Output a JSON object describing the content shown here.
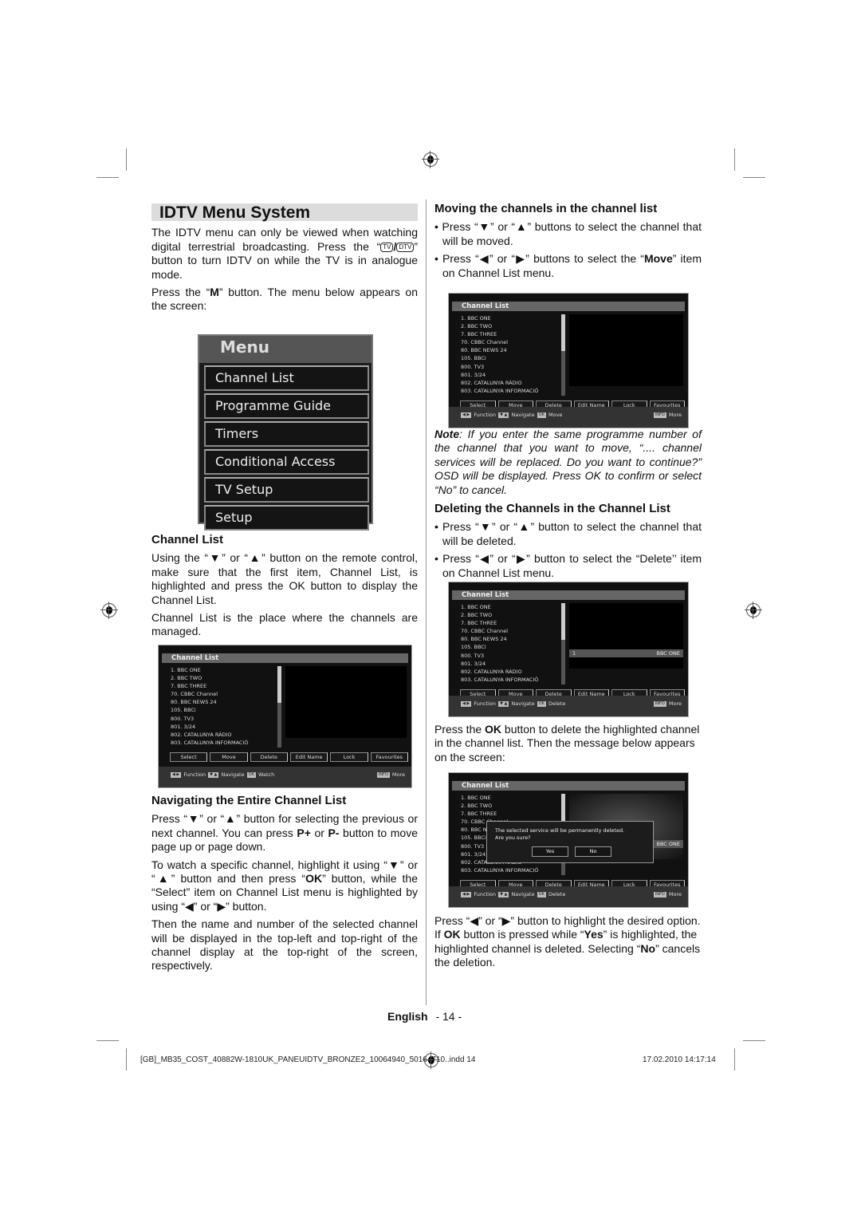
{
  "page": {
    "language_label": "English",
    "page_number": "- 14 -",
    "footer_file": "[GB]_MB35_COST_40882W-1810UK_PANEUIDTV_BRONZE2_10064940_50164710..indd  14",
    "footer_datetime": "17.02.2010  14:17:14"
  },
  "left": {
    "title": "IDTV Menu System",
    "intro_1a": "The IDTV menu can only be viewed when watching digital terrestrial broadcasting. Press the “",
    "tv_key": "TV",
    "slash": "/",
    "dtv_key": "DTV",
    "intro_1b": "” button to turn IDTV on while the TV is in analogue mode.",
    "intro_2a": "Press the “",
    "intro_2_key": "M",
    "intro_2b": "” button. The menu below appears on the screen:",
    "menu": {
      "title": "Menu",
      "items": [
        "Channel List",
        "Programme Guide",
        "Timers",
        "Conditional Access",
        "TV Setup",
        "Setup"
      ]
    },
    "channel_list_heading": "Channel List",
    "channel_list_p1": "Using the “▼” or “▲” button on the remote control, make sure that the first item, Channel List, is highlighted and press the OK button to display the Channel List.",
    "channel_list_p2": "Channel List is the place where the channels are managed.",
    "nav_heading": "Navigating the Entire Channel List",
    "nav_p1a": "Press “▼” or “▲” button for selecting the previous or next channel. You can press ",
    "nav_p1_k1": "P+",
    "nav_p1_or": " or ",
    "nav_p1_k2": "P-",
    "nav_p1b": " button to move page up or page down.",
    "nav_p2a": "To watch a specific channel, highlight it using “▼” or “▲” button and then press “",
    "nav_p2_k": "OK",
    "nav_p2b": "” button, while the “Select” item on Channel List menu is highlighted by using “◀” or “▶” button.",
    "nav_p3": "Then the name and number of the selected channel will be displayed in the top-left and top-right of the channel display at the top-right of the screen, respectively."
  },
  "right": {
    "move_heading": "Moving the channels in the channel list",
    "move_b1": "• Press “▼” or “▲” buttons to select the channel that will be moved.",
    "move_b2a": "• Press “◀” or “▶” buttons to select the “",
    "move_b2_k": "Move",
    "move_b2b": "” item on Channel List menu.",
    "note_label": "Note",
    "note_text": ": If you enter the same programme number of the channel that you want to move, “.... channel services will be replaced. Do you want to continue?” OSD will be displayed. Press OK to confirm or select “No” to cancel.",
    "delete_heading": "Deleting the Channels in the Channel List",
    "delete_b1": "• Press “▼” or “▲” button to select the channel that will be deleted.",
    "delete_b2": "• Press “◀” or “▶” button to select the “Delete’’ item on Channel List menu.",
    "press_ok_a": "Press the ",
    "press_ok_k": "OK",
    "press_ok_b": " button to delete the highlighted channel in the channel list. Then the message below appears on the screen:",
    "final_a": "Press “◀” or “▶” button to highlight the desired option. If ",
    "final_k1": "OK",
    "final_b": " button is pressed while “",
    "final_k2": "Yes",
    "final_c": "” is highlighted, the highlighted channel is deleted. Selecting “",
    "final_k3": "No",
    "final_d": "” cancels the deletion."
  },
  "channel_screen": {
    "title": "Channel List",
    "channels": [
      "1. BBC ONE",
      "2. BBC TWO",
      "7. BBC THREE",
      "70. CBBC Channel",
      "80. BBC NEWS 24",
      "105. BBCi",
      "800. TV3",
      "801. 3/24",
      "802. CATALUNYA RÀDIO",
      "803. CATALUNYA INFORMACIÓ"
    ],
    "buttons": [
      "Select",
      "Move",
      "Delete",
      "Edit Name",
      "Lock",
      "Favourites"
    ],
    "key_lr": "◀ ▶",
    "function_label": "Function",
    "key_ud": "▼ ▲",
    "navigate_label": "Navigate",
    "key_ok": "OK",
    "key_info": "INFO",
    "more_label": "More",
    "action_watch": "Watch",
    "action_move": "Move",
    "action_delete": "Delete",
    "selected_number": "1",
    "selected_name": "BBC ONE",
    "dialog_line1": "The selected service will be permanently deleted.",
    "dialog_line2": "Are you sure?",
    "dialog_yes": "Yes",
    "dialog_no": "No"
  }
}
